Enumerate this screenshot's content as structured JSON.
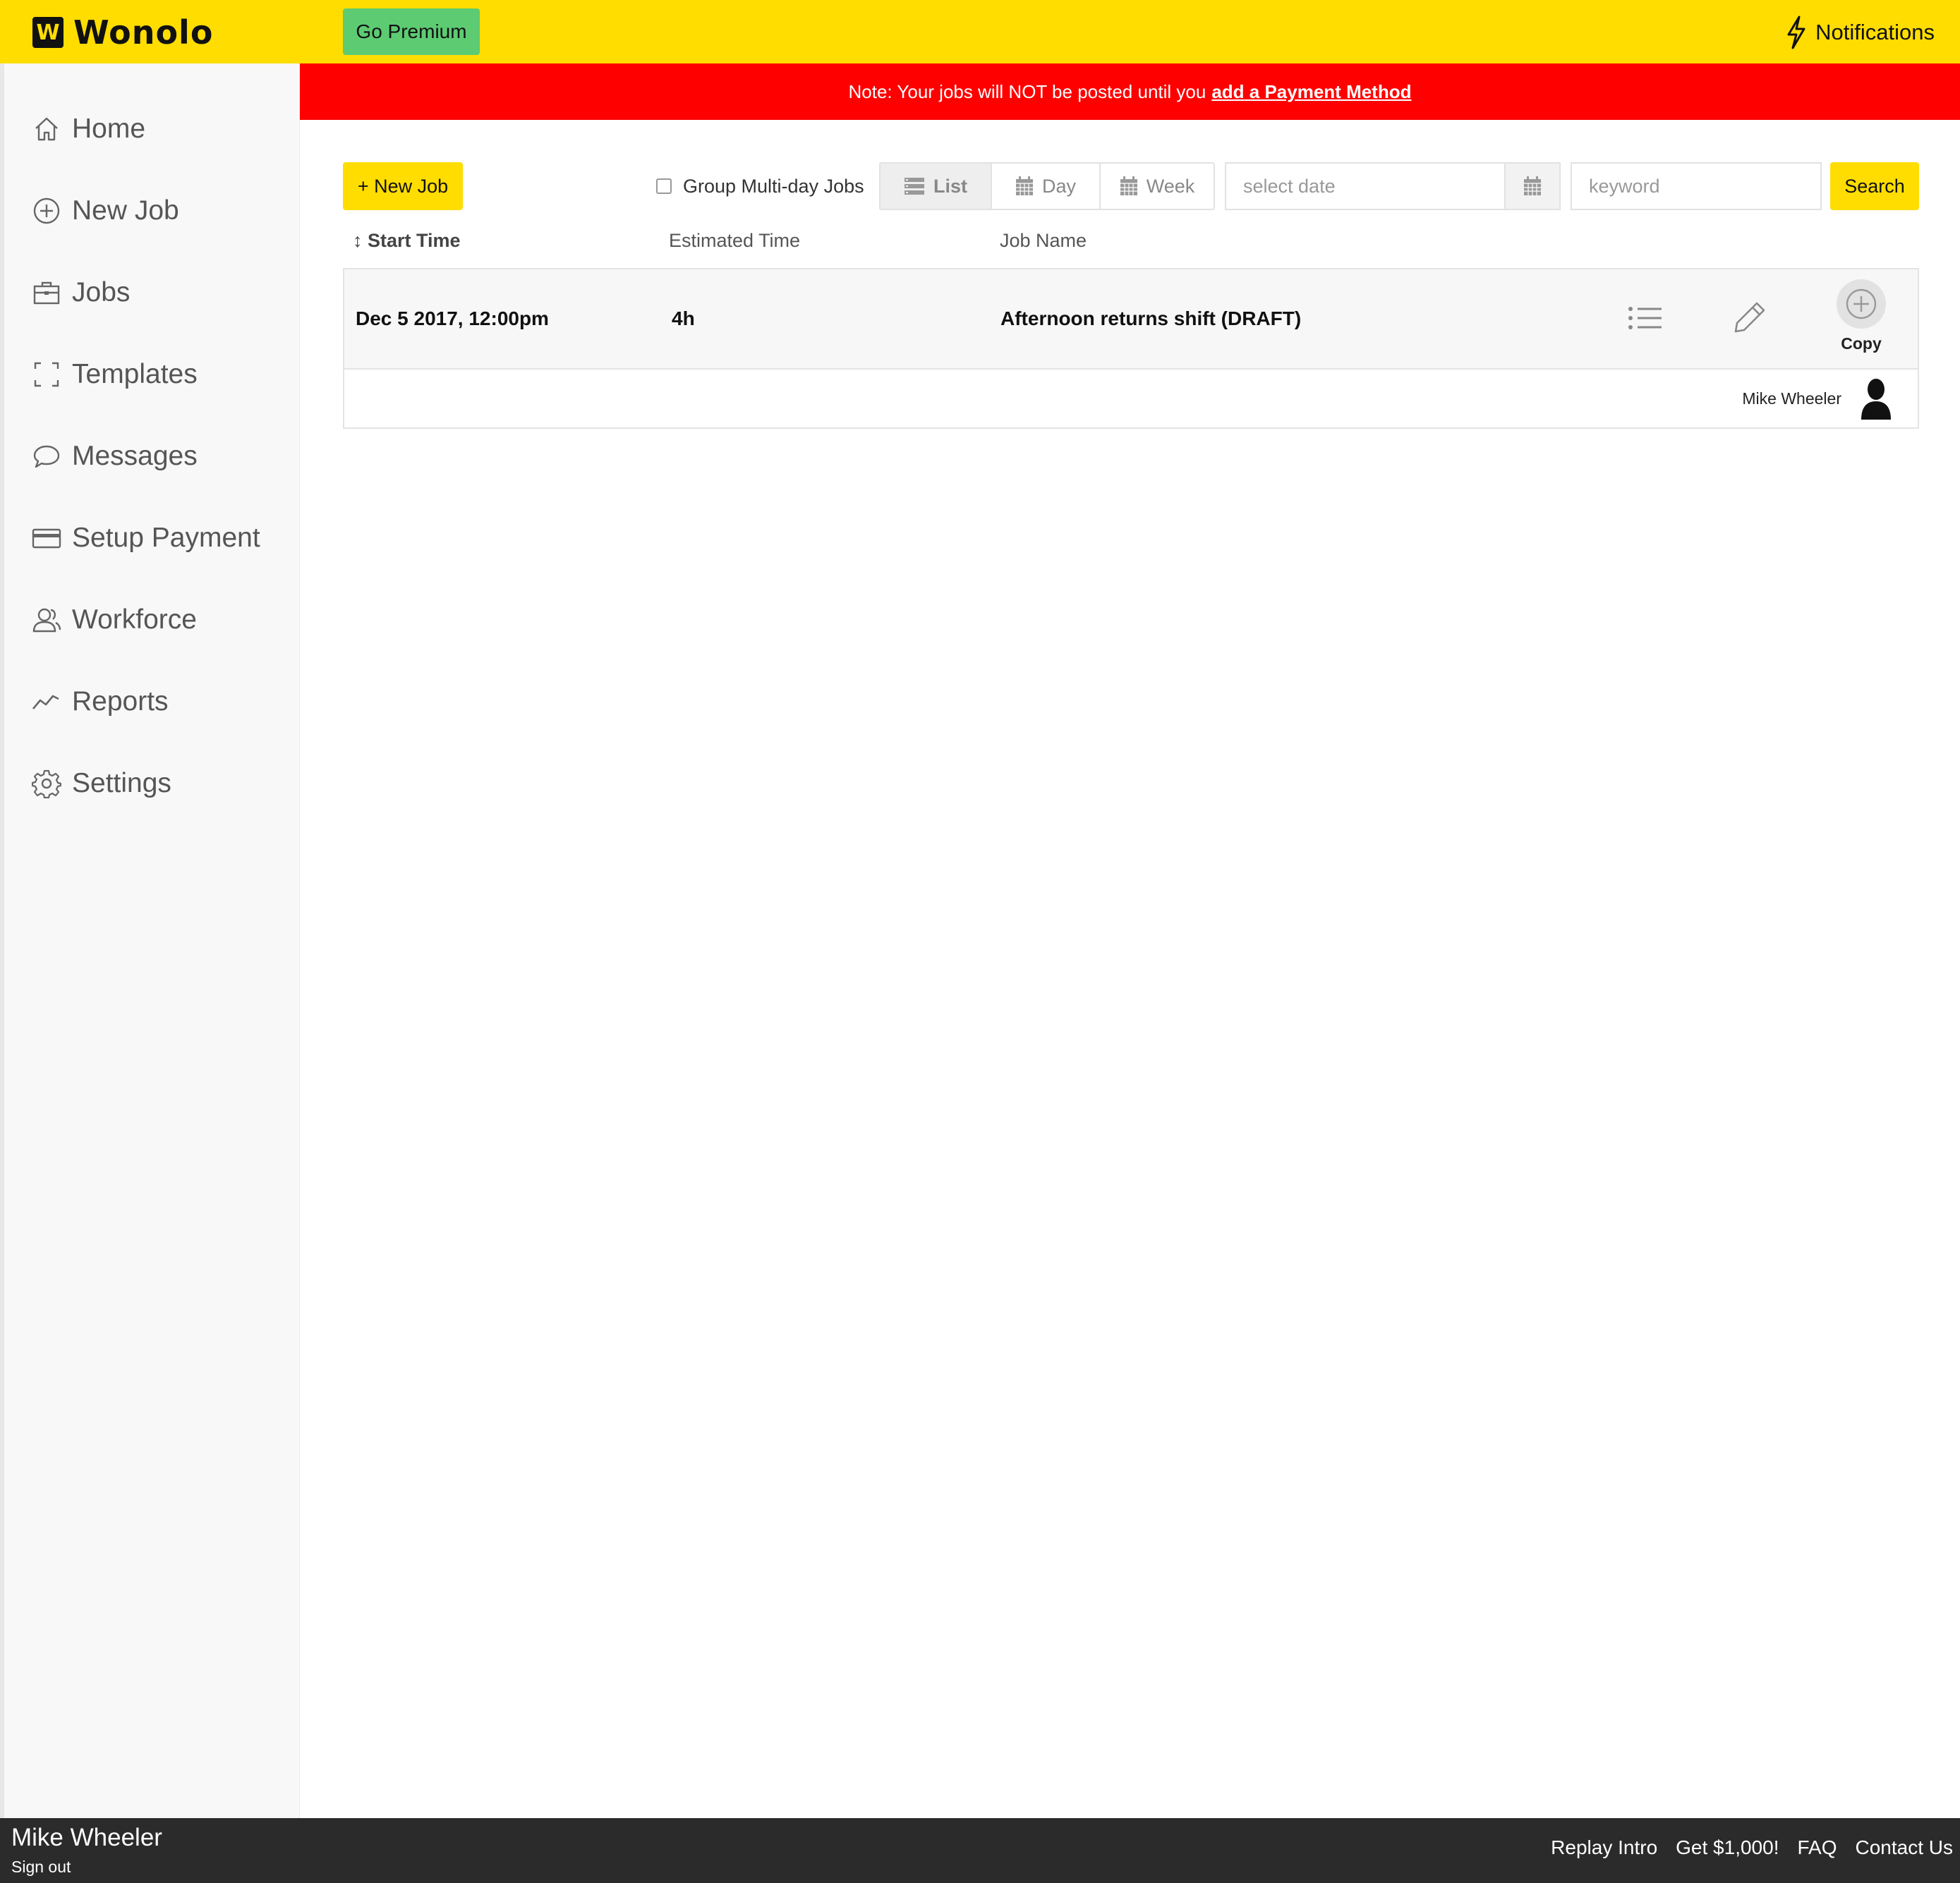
{
  "brand": {
    "name": "Wonolo",
    "mark": "W"
  },
  "topbar": {
    "premium_label": "Go Premium",
    "notifications_label": "Notifications"
  },
  "sidebar": {
    "items": [
      {
        "label": "Home",
        "icon": "home-icon"
      },
      {
        "label": "New Job",
        "icon": "plus-circle-icon"
      },
      {
        "label": "Jobs",
        "icon": "briefcase-icon"
      },
      {
        "label": "Templates",
        "icon": "template-icon"
      },
      {
        "label": "Messages",
        "icon": "speech-bubble-icon"
      },
      {
        "label": "Setup Payment",
        "icon": "credit-card-icon"
      },
      {
        "label": "Workforce",
        "icon": "people-icon"
      },
      {
        "label": "Reports",
        "icon": "line-chart-icon"
      },
      {
        "label": "Settings",
        "icon": "gear-icon"
      }
    ]
  },
  "alert": {
    "text": "Note: Your jobs will NOT be posted until you",
    "link": "add a Payment Method"
  },
  "toolbar": {
    "new_job_label": "+ New Job",
    "group_multiday_label": "Group Multi-day Jobs",
    "group_multiday_checked": false,
    "views": [
      {
        "label": "List",
        "active": true
      },
      {
        "label": "Day",
        "active": false
      },
      {
        "label": "Week",
        "active": false
      }
    ],
    "date_placeholder": "select date",
    "keyword_placeholder": "keyword",
    "search_label": "Search"
  },
  "table": {
    "headers": {
      "start_time": "Start Time",
      "estimated_time": "Estimated Time",
      "job_name": "Job Name"
    },
    "rows": [
      {
        "start_time": "Dec 5 2017, 12:00pm",
        "estimated_time": "4h",
        "job_name": "Afternoon returns shift (DRAFT)",
        "copy_label": "Copy",
        "assignee": "Mike Wheeler"
      }
    ]
  },
  "footer": {
    "user_name": "Mike Wheeler",
    "sign_out": "Sign out",
    "links": [
      "Replay Intro",
      "Get $1,000!",
      "FAQ",
      "Contact Us"
    ]
  },
  "colors": {
    "brand_yellow": "#ffdd00",
    "premium_green": "#5dcb72",
    "alert_red": "#ff0000",
    "footer_dark": "#2b2b2b"
  }
}
